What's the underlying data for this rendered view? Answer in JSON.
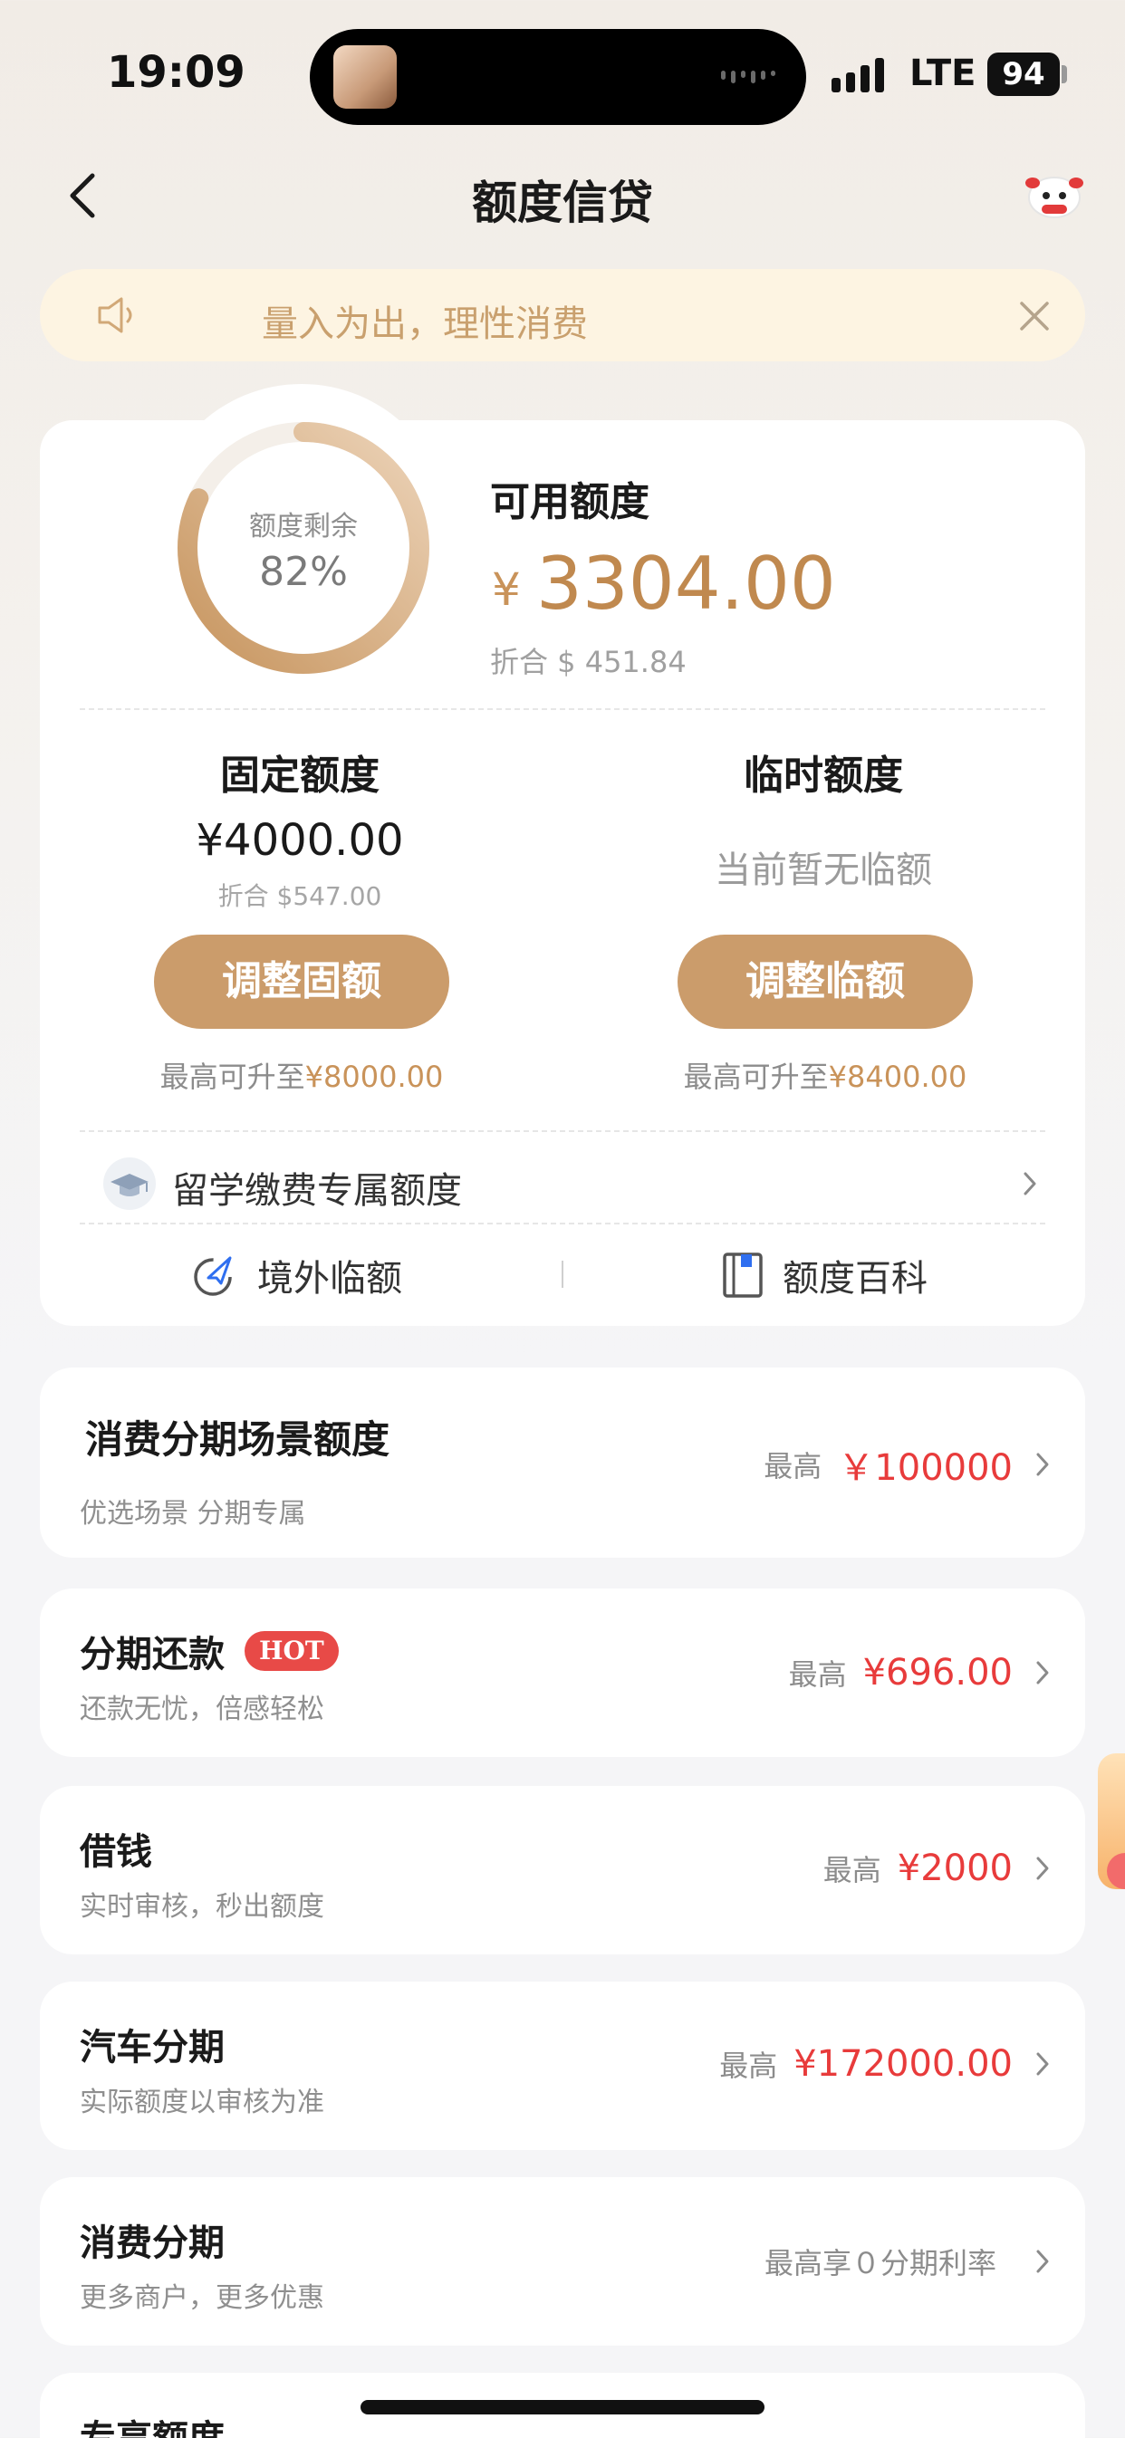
{
  "status": {
    "time": "19:09",
    "network": "LTE",
    "battery": "94"
  },
  "nav": {
    "title": "额度信贷"
  },
  "notice": {
    "text": "量入为出，理性消费"
  },
  "summary": {
    "ring_label": "额度剩余",
    "ring_percent": "82%",
    "ring_fraction": 0.82,
    "available_label": "可用额度",
    "currency_symbol": "¥",
    "available_amount": "3304.00",
    "available_usd": "折合 $ 451.84"
  },
  "fixed": {
    "title": "固定额度",
    "amount": "¥4000.00",
    "usd": "折合 $547.00",
    "button": "调整固额",
    "max_prefix": "最高可升至",
    "max_value": "¥8000.00"
  },
  "temporary": {
    "title": "临时额度",
    "none_text": "当前暂无临额",
    "button": "调整临额",
    "max_prefix": "最高可升至",
    "max_value": "¥8400.00"
  },
  "study": {
    "label": "留学缴费专属额度"
  },
  "tools": {
    "overseas": "境外临额",
    "encyclopedia": "额度百科"
  },
  "scene": {
    "title": "消费分期场景额度",
    "sub": "优选场景 分期专属",
    "max_label": "最高",
    "max_value": "￥100000"
  },
  "products": [
    {
      "title": "分期还款",
      "badge": "HOT",
      "sub": "还款无忧，倍感轻松",
      "max_label": "最高",
      "max_value": "¥696.00"
    },
    {
      "title": "借钱",
      "sub": "实时审核，秒出额度",
      "max_label": "最高",
      "max_value": "¥2000"
    },
    {
      "title": "汽车分期",
      "sub": "实际额度以审核为准",
      "max_label": "最高",
      "max_value": "¥172000.00"
    },
    {
      "title": "消费分期",
      "sub": "更多商户，更多优惠",
      "max_label": "最高享０分期利率"
    },
    {
      "title": "专享额度"
    }
  ],
  "colors": {
    "gold": "#c0894f",
    "button": "#cb9c6b",
    "red": "#e83b3b",
    "notice_bg": "#fdf4e2"
  }
}
